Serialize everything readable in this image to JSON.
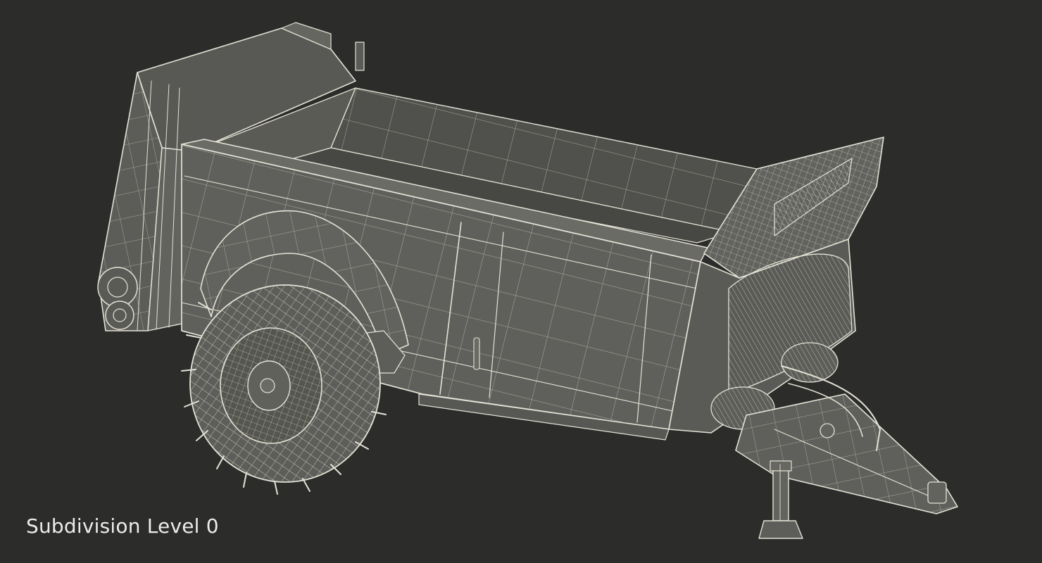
{
  "viewport": {
    "background_color": "#2c2c2b",
    "model_color": "#5f605b",
    "wire_color": "#e4e2d6"
  },
  "render": {
    "subject_icon": "manure-spreader-wireframe-model"
  },
  "caption": {
    "text": "Subdivision Level 0"
  }
}
